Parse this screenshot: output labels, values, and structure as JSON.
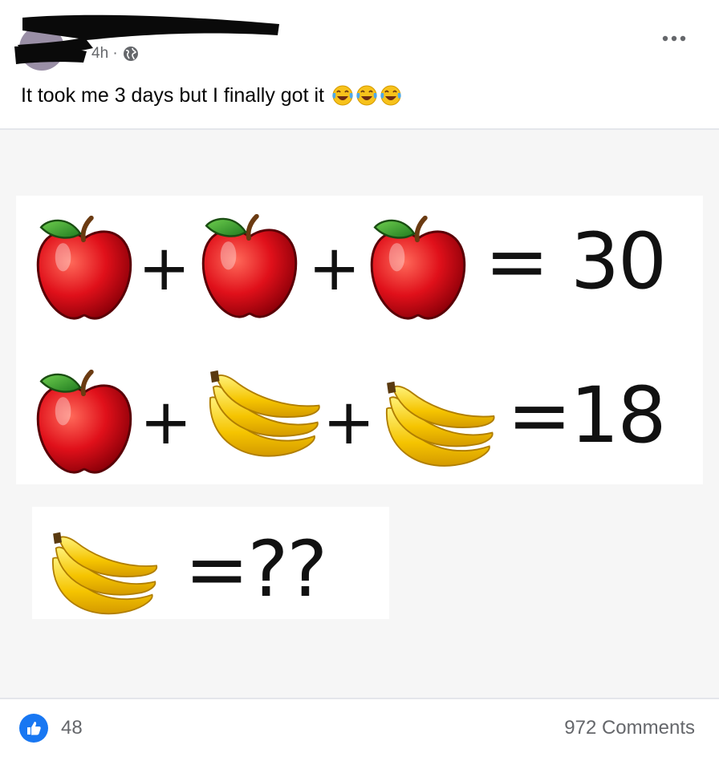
{
  "post": {
    "timestamp": "4h ·",
    "privacy_icon": "globe-icon",
    "more_icon": "more-options-icon",
    "text": "It took me 3 days but I finally got it",
    "emojis": [
      "tears-of-joy-icon",
      "tears-of-joy-icon",
      "tears-of-joy-icon"
    ]
  },
  "puzzle": {
    "row1": {
      "ops": [
        "+",
        "+"
      ],
      "result": "= 30"
    },
    "row2": {
      "ops": [
        "+",
        "+"
      ],
      "result": "=18"
    },
    "row3": {
      "result": "=??"
    }
  },
  "footer": {
    "like_icon": "thumbs-up-icon",
    "like_count": "48",
    "comments": "972 Comments"
  },
  "colors": {
    "accent": "#1877f2",
    "apple": "#e0101a",
    "banana": "#f5c400",
    "muted_text": "#65676b"
  }
}
